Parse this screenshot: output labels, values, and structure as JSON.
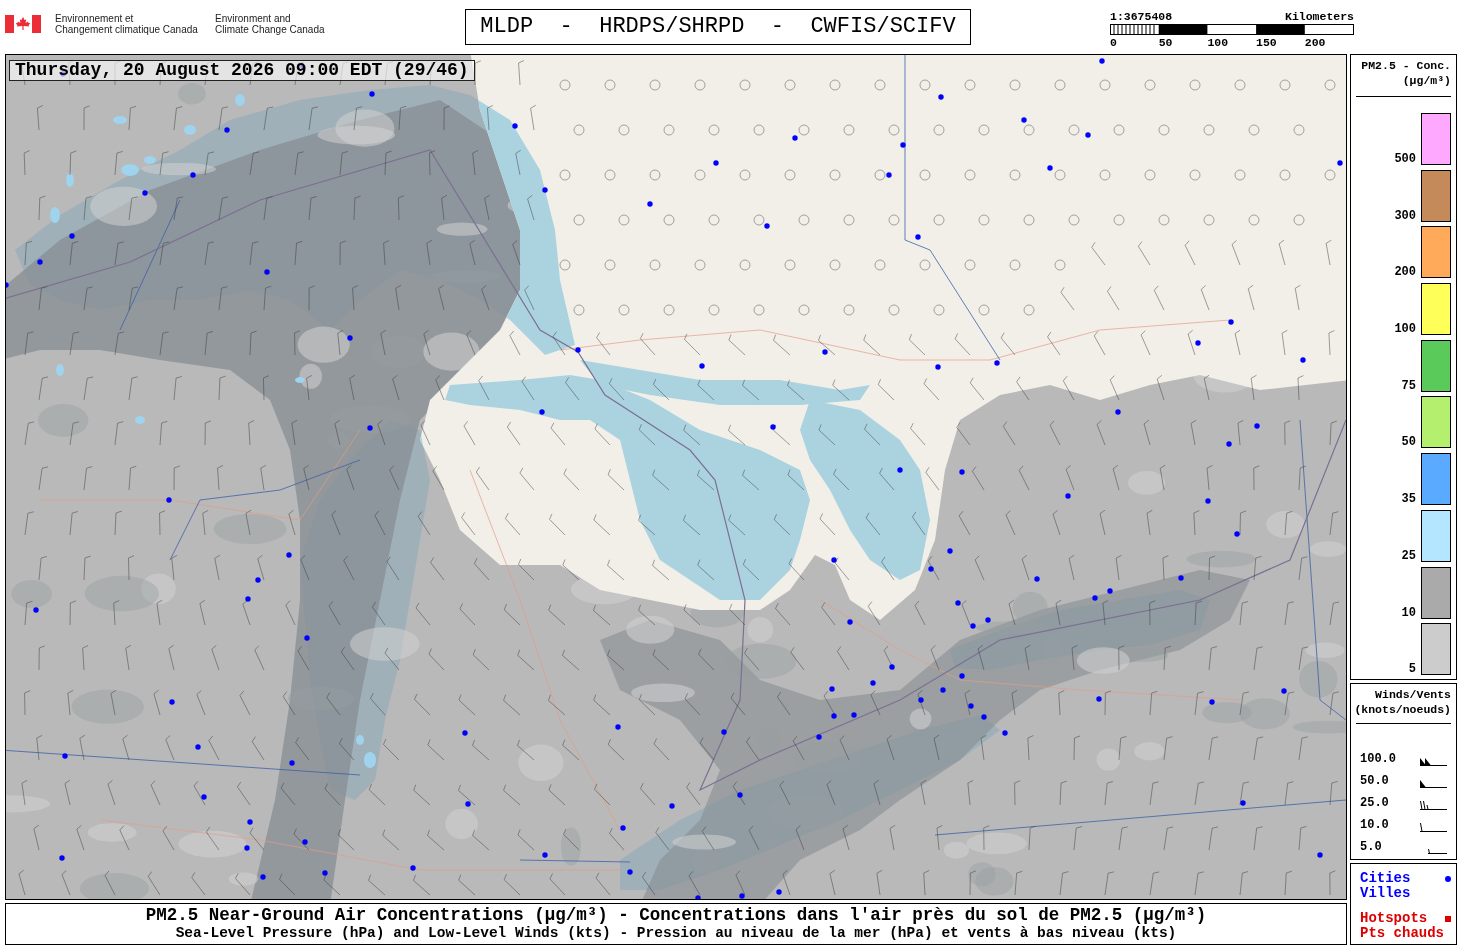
{
  "header": {
    "agencies": [
      {
        "lines": [
          "Environnement et",
          "Changement climatique Canada"
        ]
      },
      {
        "lines": [
          "Environment and",
          "Climate Change Canada"
        ]
      }
    ],
    "title": "MLDP  -  HRDPS/SHRPD  -  CWFIS/SCIFV",
    "scale": {
      "ratio": "1:3675408",
      "unit": "Kilometers",
      "ticks": [
        "0",
        "50",
        "100",
        "150",
        "200"
      ]
    }
  },
  "map": {
    "timestamp": "Thursday, 20 August 2026 09:00 EDT (29/46)"
  },
  "concentration_legend": {
    "title": "PM2.5 - Conc.",
    "unit": "(µg/m³)",
    "levels": [
      {
        "label": "500",
        "color": "#ffa8ff"
      },
      {
        "label": "300",
        "color": "#c48a5a"
      },
      {
        "label": "200",
        "color": "#ffaa5a"
      },
      {
        "label": "100",
        "color": "#ffff5a"
      },
      {
        "label": "75",
        "color": "#5acb5a"
      },
      {
        "label": "50",
        "color": "#b4f06e"
      },
      {
        "label": "35",
        "color": "#5aaaff"
      },
      {
        "label": "25",
        "color": "#b4e6ff"
      },
      {
        "label": "10",
        "color": "#aaaaaa"
      },
      {
        "label": "5",
        "color": "#cccccc"
      }
    ]
  },
  "wind_legend": {
    "title": "Winds/Vents",
    "unit": "(knots/noeuds)",
    "rows": [
      {
        "value": "100.0",
        "kind": "pennants"
      },
      {
        "value": "50.0",
        "kind": "pennant"
      },
      {
        "value": "25.0",
        "kind": "barbs"
      },
      {
        "value": "10.0",
        "kind": "barb"
      },
      {
        "value": "5.0",
        "kind": "halfbarb"
      }
    ]
  },
  "symbol_legend": [
    {
      "kind": "city",
      "lines": [
        "Cities",
        "Villes"
      ],
      "color": "#0000ff"
    },
    {
      "kind": "hotspot",
      "lines": [
        "Hotspots",
        "Pts chauds"
      ],
      "color": "#dd0000"
    }
  ],
  "caption": {
    "title": "PM2.5 Near-Ground Air Concentrations (µg/m³) - Concentrations dans l'air près du sol de PM2.5 (µg/m³)",
    "subtitle": "Sea-Level Pressure (hPa) and Low-Level Winds (kts) - Pression au niveau de la mer (hPa) et vents à bas niveau (kts)"
  }
}
